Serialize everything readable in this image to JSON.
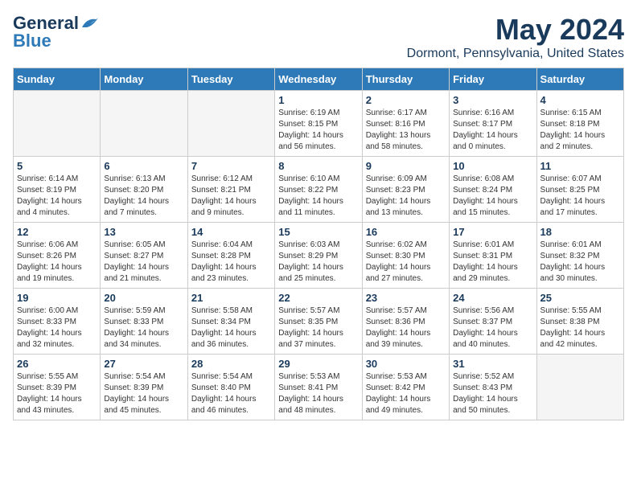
{
  "logo": {
    "general": "General",
    "blue": "Blue"
  },
  "title": "May 2024",
  "location": "Dormont, Pennsylvania, United States",
  "weekdays": [
    "Sunday",
    "Monday",
    "Tuesday",
    "Wednesday",
    "Thursday",
    "Friday",
    "Saturday"
  ],
  "weeks": [
    [
      {
        "day": "",
        "info": ""
      },
      {
        "day": "",
        "info": ""
      },
      {
        "day": "",
        "info": ""
      },
      {
        "day": "1",
        "info": "Sunrise: 6:19 AM\nSunset: 8:15 PM\nDaylight: 14 hours\nand 56 minutes."
      },
      {
        "day": "2",
        "info": "Sunrise: 6:17 AM\nSunset: 8:16 PM\nDaylight: 13 hours\nand 58 minutes."
      },
      {
        "day": "3",
        "info": "Sunrise: 6:16 AM\nSunset: 8:17 PM\nDaylight: 14 hours\nand 0 minutes."
      },
      {
        "day": "4",
        "info": "Sunrise: 6:15 AM\nSunset: 8:18 PM\nDaylight: 14 hours\nand 2 minutes."
      }
    ],
    [
      {
        "day": "5",
        "info": "Sunrise: 6:14 AM\nSunset: 8:19 PM\nDaylight: 14 hours\nand 4 minutes."
      },
      {
        "day": "6",
        "info": "Sunrise: 6:13 AM\nSunset: 8:20 PM\nDaylight: 14 hours\nand 7 minutes."
      },
      {
        "day": "7",
        "info": "Sunrise: 6:12 AM\nSunset: 8:21 PM\nDaylight: 14 hours\nand 9 minutes."
      },
      {
        "day": "8",
        "info": "Sunrise: 6:10 AM\nSunset: 8:22 PM\nDaylight: 14 hours\nand 11 minutes."
      },
      {
        "day": "9",
        "info": "Sunrise: 6:09 AM\nSunset: 8:23 PM\nDaylight: 14 hours\nand 13 minutes."
      },
      {
        "day": "10",
        "info": "Sunrise: 6:08 AM\nSunset: 8:24 PM\nDaylight: 14 hours\nand 15 minutes."
      },
      {
        "day": "11",
        "info": "Sunrise: 6:07 AM\nSunset: 8:25 PM\nDaylight: 14 hours\nand 17 minutes."
      }
    ],
    [
      {
        "day": "12",
        "info": "Sunrise: 6:06 AM\nSunset: 8:26 PM\nDaylight: 14 hours\nand 19 minutes."
      },
      {
        "day": "13",
        "info": "Sunrise: 6:05 AM\nSunset: 8:27 PM\nDaylight: 14 hours\nand 21 minutes."
      },
      {
        "day": "14",
        "info": "Sunrise: 6:04 AM\nSunset: 8:28 PM\nDaylight: 14 hours\nand 23 minutes."
      },
      {
        "day": "15",
        "info": "Sunrise: 6:03 AM\nSunset: 8:29 PM\nDaylight: 14 hours\nand 25 minutes."
      },
      {
        "day": "16",
        "info": "Sunrise: 6:02 AM\nSunset: 8:30 PM\nDaylight: 14 hours\nand 27 minutes."
      },
      {
        "day": "17",
        "info": "Sunrise: 6:01 AM\nSunset: 8:31 PM\nDaylight: 14 hours\nand 29 minutes."
      },
      {
        "day": "18",
        "info": "Sunrise: 6:01 AM\nSunset: 8:32 PM\nDaylight: 14 hours\nand 30 minutes."
      }
    ],
    [
      {
        "day": "19",
        "info": "Sunrise: 6:00 AM\nSunset: 8:33 PM\nDaylight: 14 hours\nand 32 minutes."
      },
      {
        "day": "20",
        "info": "Sunrise: 5:59 AM\nSunset: 8:33 PM\nDaylight: 14 hours\nand 34 minutes."
      },
      {
        "day": "21",
        "info": "Sunrise: 5:58 AM\nSunset: 8:34 PM\nDaylight: 14 hours\nand 36 minutes."
      },
      {
        "day": "22",
        "info": "Sunrise: 5:57 AM\nSunset: 8:35 PM\nDaylight: 14 hours\nand 37 minutes."
      },
      {
        "day": "23",
        "info": "Sunrise: 5:57 AM\nSunset: 8:36 PM\nDaylight: 14 hours\nand 39 minutes."
      },
      {
        "day": "24",
        "info": "Sunrise: 5:56 AM\nSunset: 8:37 PM\nDaylight: 14 hours\nand 40 minutes."
      },
      {
        "day": "25",
        "info": "Sunrise: 5:55 AM\nSunset: 8:38 PM\nDaylight: 14 hours\nand 42 minutes."
      }
    ],
    [
      {
        "day": "26",
        "info": "Sunrise: 5:55 AM\nSunset: 8:39 PM\nDaylight: 14 hours\nand 43 minutes."
      },
      {
        "day": "27",
        "info": "Sunrise: 5:54 AM\nSunset: 8:39 PM\nDaylight: 14 hours\nand 45 minutes."
      },
      {
        "day": "28",
        "info": "Sunrise: 5:54 AM\nSunset: 8:40 PM\nDaylight: 14 hours\nand 46 minutes."
      },
      {
        "day": "29",
        "info": "Sunrise: 5:53 AM\nSunset: 8:41 PM\nDaylight: 14 hours\nand 48 minutes."
      },
      {
        "day": "30",
        "info": "Sunrise: 5:53 AM\nSunset: 8:42 PM\nDaylight: 14 hours\nand 49 minutes."
      },
      {
        "day": "31",
        "info": "Sunrise: 5:52 AM\nSunset: 8:43 PM\nDaylight: 14 hours\nand 50 minutes."
      },
      {
        "day": "",
        "info": ""
      }
    ]
  ]
}
